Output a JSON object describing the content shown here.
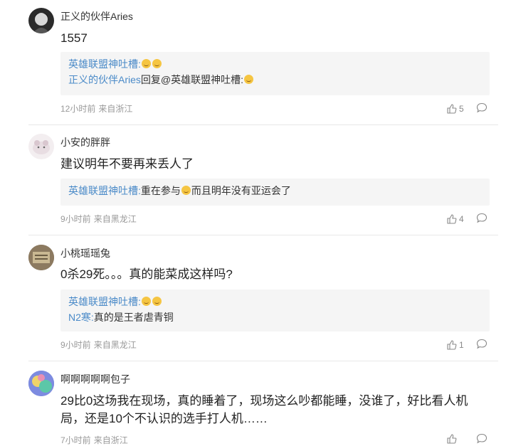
{
  "comments": [
    {
      "username": "正义的伙伴Aries",
      "text": "1557",
      "replies": [
        {
          "name": "英雄联盟神吐槽:",
          "text": "",
          "emojis": 2
        },
        {
          "name": "正义的伙伴Aries",
          "text": "回复@英雄联盟神吐槽:",
          "emojis": 1
        }
      ],
      "time": "12小时前",
      "location": "来自浙江",
      "likes": "5"
    },
    {
      "username": "小安的胖胖",
      "text": "建议明年不要再来丢人了",
      "replies": [
        {
          "name": "英雄联盟神吐槽:",
          "text": "重在参与",
          "emojis": 1,
          "text2": "而且明年没有亚运会了"
        }
      ],
      "time": "9小时前",
      "location": "来自黑龙江",
      "likes": "4"
    },
    {
      "username": "小桃瑶瑶兔",
      "text": "0杀29死。。。真的能菜成这样吗?",
      "replies": [
        {
          "name": "英雄联盟神吐槽:",
          "text": "",
          "emojis": 2
        },
        {
          "name": "N2寒:",
          "text": "真的是王者虐青铜",
          "emojis": 0
        }
      ],
      "time": "9小时前",
      "location": "来自黑龙江",
      "likes": "1"
    },
    {
      "username": "啊啊啊啊啊包子",
      "text": "29比0这场我在现场，真的睡着了，现场这么吵都能睡，没谁了，好比看人机局，还是10个不认识的选手打人机……",
      "replies": [],
      "time": "7小时前",
      "location": "来自浙江",
      "likes": ""
    }
  ],
  "icons": {
    "like": "thumbs-up-icon",
    "comment": "comment-bubble-icon"
  },
  "colors": {
    "reply_name": "#4a8ac8",
    "reply_bg": "#f5f5f5",
    "meta": "#999999"
  }
}
